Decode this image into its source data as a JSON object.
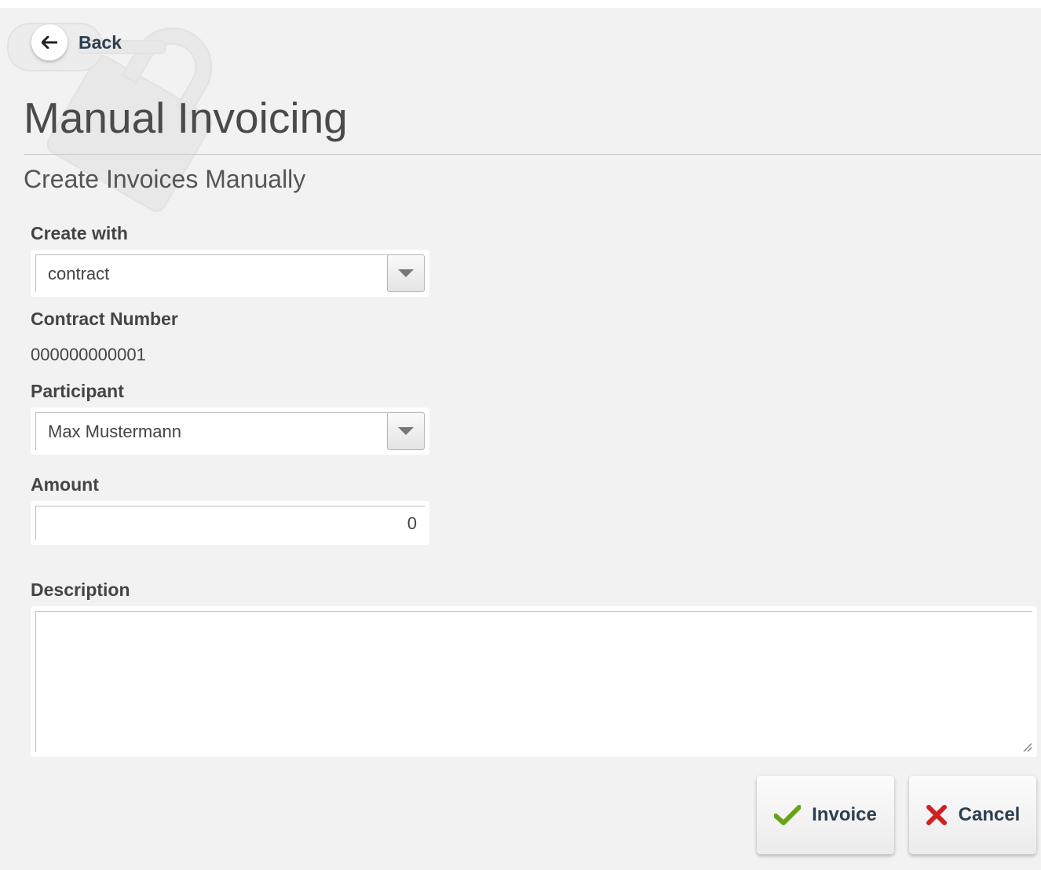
{
  "nav": {
    "back_label": "Back"
  },
  "header": {
    "title": "Manual Invoicing",
    "subtitle": "Create Invoices Manually"
  },
  "form": {
    "create_with": {
      "label": "Create with",
      "value": "contract"
    },
    "contract_number": {
      "label": "Contract Number",
      "value": "000000000001"
    },
    "participant": {
      "label": "Participant",
      "value": "Max Mustermann"
    },
    "amount": {
      "label": "Amount",
      "value": "0"
    },
    "description": {
      "label": "Description",
      "value": ""
    }
  },
  "actions": {
    "invoice_label": "Invoice",
    "cancel_label": "Cancel"
  },
  "icons": {
    "back": "arrow-left-icon",
    "dropdown": "chevron-down-icon",
    "invoice": "checkmark-icon",
    "cancel": "close-icon",
    "resize": "resize-grip-icon"
  },
  "colors": {
    "background": "#f2f2f2",
    "text_dark": "#2d3e50",
    "check_green": "#6aa31a",
    "cancel_red": "#cc2222"
  }
}
